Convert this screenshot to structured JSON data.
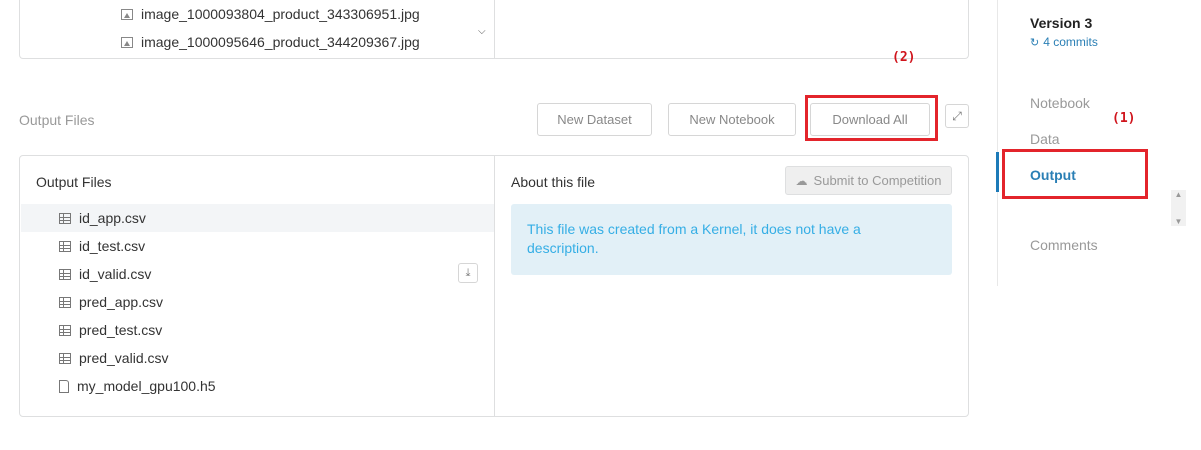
{
  "top_panel": {
    "files": [
      "image_1000093804_product_343306951.jpg",
      "image_1000095646_product_344209367.jpg"
    ]
  },
  "output_header": {
    "title": "Output Files",
    "new_dataset": "New Dataset",
    "new_notebook": "New Notebook",
    "download_all": "Download All"
  },
  "annotations": {
    "download_label": "(2)",
    "output_label": "(1)"
  },
  "files_panel": {
    "title": "Output Files",
    "files": [
      {
        "name": "id_app.csv",
        "icon": "table-icon"
      },
      {
        "name": "id_test.csv",
        "icon": "table-icon"
      },
      {
        "name": "id_valid.csv",
        "icon": "table-icon"
      },
      {
        "name": "pred_app.csv",
        "icon": "table-icon"
      },
      {
        "name": "pred_test.csv",
        "icon": "table-icon"
      },
      {
        "name": "pred_valid.csv",
        "icon": "table-icon"
      },
      {
        "name": "my_model_gpu100.h5",
        "icon": "file-icon"
      }
    ]
  },
  "about": {
    "title": "About this file",
    "submit_label": "Submit to Competition",
    "description": "This file was created from a Kernel, it does not have a description."
  },
  "sidebar": {
    "version": "Version 3",
    "commits": "4 commits",
    "nav": [
      "Notebook",
      "Data",
      "Output",
      "Comments"
    ],
    "active": "Output"
  },
  "colors": {
    "accent": "#2a7fb5",
    "highlight": "#e3242b",
    "info_bg": "#e2f0f7",
    "info_text": "#35aee5"
  }
}
